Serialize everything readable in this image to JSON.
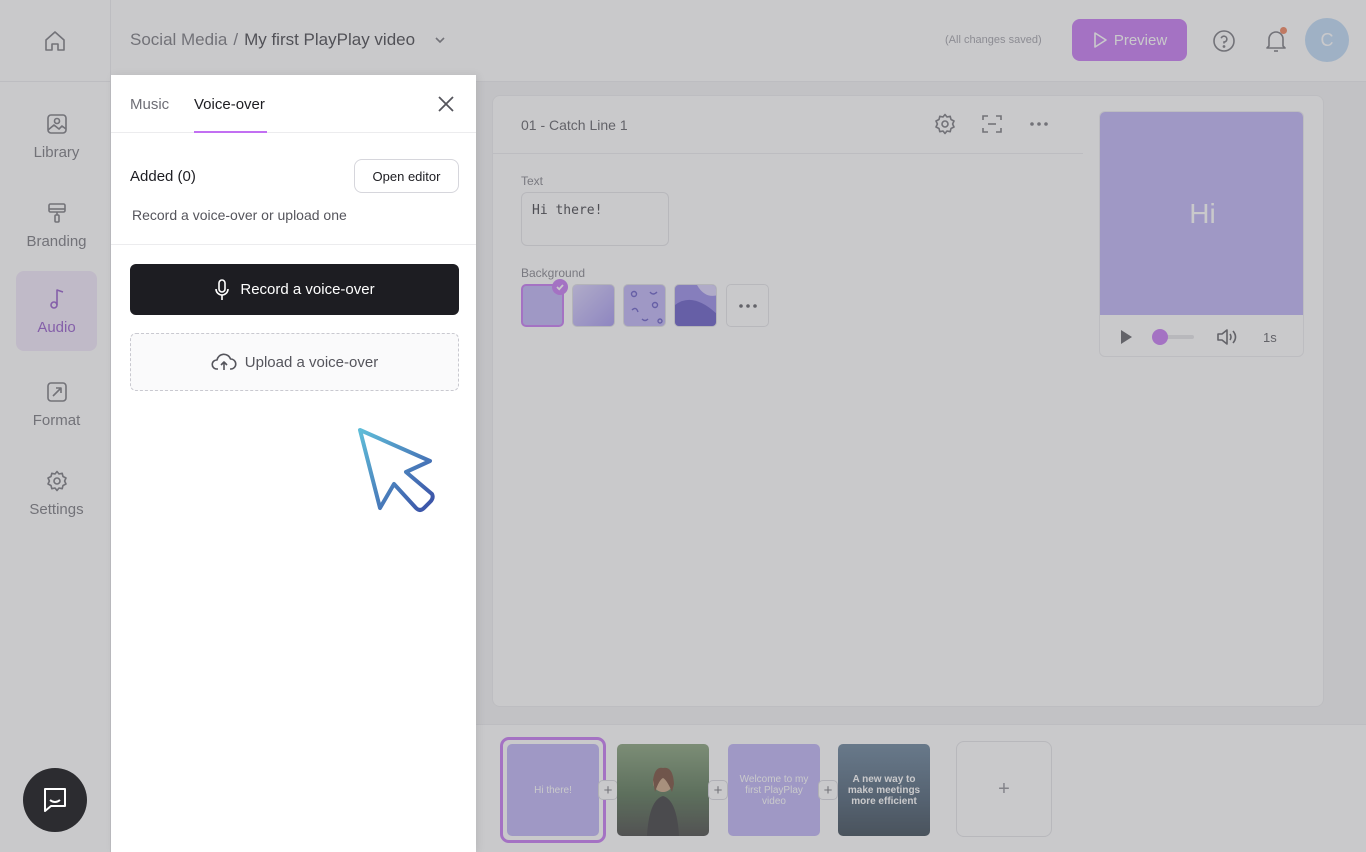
{
  "header": {
    "breadcrumb_root": "Social Media",
    "breadcrumb_sep": "/",
    "breadcrumb_current": "My first PlayPlay video",
    "save_status": "(All changes saved)",
    "preview_label": "Preview",
    "avatar_initial": "C"
  },
  "sidebar": {
    "items": [
      {
        "label": "Library",
        "icon": "image-icon"
      },
      {
        "label": "Branding",
        "icon": "paint-roller-icon"
      },
      {
        "label": "Audio",
        "icon": "music-note-icon"
      },
      {
        "label": "Format",
        "icon": "resize-icon"
      },
      {
        "label": "Settings",
        "icon": "gear-icon"
      }
    ]
  },
  "audio_panel": {
    "tabs": [
      {
        "label": "Music"
      },
      {
        "label": "Voice-over"
      }
    ],
    "active_tab": "Voice-over",
    "added_label": "Added (0)",
    "open_editor_label": "Open editor",
    "hint": "Record a voice-over or upload one",
    "record_label": "Record a voice-over",
    "upload_label": "Upload a voice-over"
  },
  "scene": {
    "title": "01 - Catch Line 1",
    "text_label": "Text",
    "text_value": "Hi there!",
    "background_label": "Background",
    "preview_text": "Hi",
    "duration": "1s"
  },
  "timeline": {
    "scenes": [
      {
        "text": "Hi there!"
      },
      {
        "text": ""
      },
      {
        "text": "Welcome to my first PlayPlay video"
      },
      {
        "text": "A new way to make meetings more efficient"
      }
    ],
    "add_symbol": "+"
  },
  "colors": {
    "accent": "#c26ff2",
    "dark_button": "#1d1d22",
    "scene_purple": "#b9aef5"
  }
}
